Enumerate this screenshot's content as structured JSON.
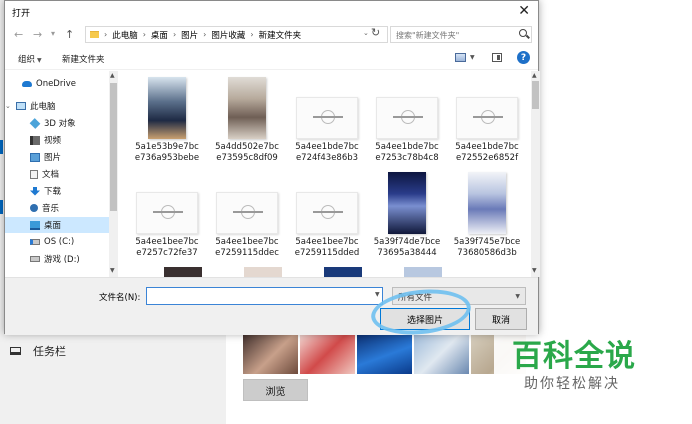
{
  "dialog": {
    "title": "打开",
    "breadcrumb": [
      "此电脑",
      "桌面",
      "图片",
      "图片收藏",
      "新建文件夹"
    ],
    "search_placeholder": "搜索\"新建文件夹\"",
    "toolbar": {
      "organize": "组织",
      "new_folder": "新建文件夹"
    },
    "sidebar": [
      {
        "label": "OneDrive",
        "icon": "onedrive-icon"
      },
      {
        "label": "此电脑",
        "icon": "computer-icon"
      },
      {
        "label": "3D 对象",
        "icon": "3d-objects-icon"
      },
      {
        "label": "视频",
        "icon": "video-icon"
      },
      {
        "label": "图片",
        "icon": "pictures-icon"
      },
      {
        "label": "文档",
        "icon": "documents-icon"
      },
      {
        "label": "下载",
        "icon": "downloads-icon"
      },
      {
        "label": "音乐",
        "icon": "music-icon"
      },
      {
        "label": "桌面",
        "icon": "desktop-icon"
      },
      {
        "label": "OS (C:)",
        "icon": "drive-icon"
      },
      {
        "label": "游戏 (D:)",
        "icon": "drive-icon"
      }
    ],
    "files": [
      {
        "line1": "5a1e53b9e7bc",
        "line2": "e736a953bebe"
      },
      {
        "line1": "5a4dd502e7bc",
        "line2": "e73595c8df09"
      },
      {
        "line1": "5a4ee1bde7bc",
        "line2": "e724f43e86b3"
      },
      {
        "line1": "5a4ee1bde7bc",
        "line2": "e7253c78b4c8"
      },
      {
        "line1": "5a4ee1bde7bc",
        "line2": "e72552e6852f"
      },
      {
        "line1": "5a4ee1bee7bc",
        "line2": "e7257c72fe37"
      },
      {
        "line1": "5a4ee1bee7bc",
        "line2": "e7259115ddec"
      },
      {
        "line1": "5a4ee1bee7bc",
        "line2": "e7259115dded"
      },
      {
        "line1": "5a39f74de7bce",
        "line2": "73695a38444"
      },
      {
        "line1": "5a39f745e7bce",
        "line2": "73680586d3b"
      }
    ],
    "filename_label": "文件名(N):",
    "filename_value": "",
    "filetype_value": "所有文件",
    "open_button": "选择图片",
    "cancel_button": "取消"
  },
  "background": {
    "nav_taskbar": "任务栏",
    "browse_button": "浏览"
  },
  "watermark": {
    "title": "百科全说",
    "subtitle": "助你轻松解决"
  },
  "colors": {
    "accent": "#0078d7",
    "watermark_green": "#2aa84a",
    "selection": "#cce8ff"
  }
}
